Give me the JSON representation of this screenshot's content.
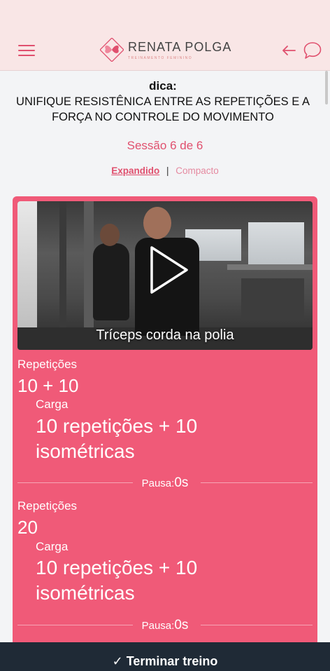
{
  "header": {
    "brand_name": "RENATA POLGA",
    "brand_subtitle": "TREINAMENTO FEMININO",
    "icons": {
      "menu": "hamburger-menu-icon",
      "back": "arrow-left-icon",
      "chat": "chat-bubble-icon"
    },
    "colors": {
      "background": "#f9e6e6",
      "accent": "#e0506e"
    }
  },
  "tip": {
    "title": "dica:",
    "text": "UNIFIQUE RESISTÊNICA ENTRE AS REPETIÇÕES E A FORÇA NO CONTROLE DO MOVIMENTO"
  },
  "session_label": "Sessão 6 de 6",
  "view_toggle": {
    "expanded_label": "Expandido",
    "separator": "|",
    "compact_label": "Compacto",
    "active": "Expandido"
  },
  "exercise": {
    "video_title": "Tríceps corda na polia",
    "card_color": "#f05a78",
    "sets": [
      {
        "reps_label": "Repetições",
        "reps_value": "10 + 10",
        "load_label": "Carga",
        "load_value": "10 repetições + 10 isométricas",
        "pause_label": "Pausa:",
        "pause_value": "0s"
      },
      {
        "reps_label": "Repetições",
        "reps_value": "20",
        "load_label": "Carga",
        "load_value": "10 repetições + 10 isométricas",
        "pause_label": "Pausa:",
        "pause_value": "0s"
      }
    ]
  },
  "footer": {
    "finish_icon": "checkmark",
    "finish_label": "Terminar treino",
    "finish_text": "✓ Terminar treino",
    "color": "#1f2a36"
  }
}
